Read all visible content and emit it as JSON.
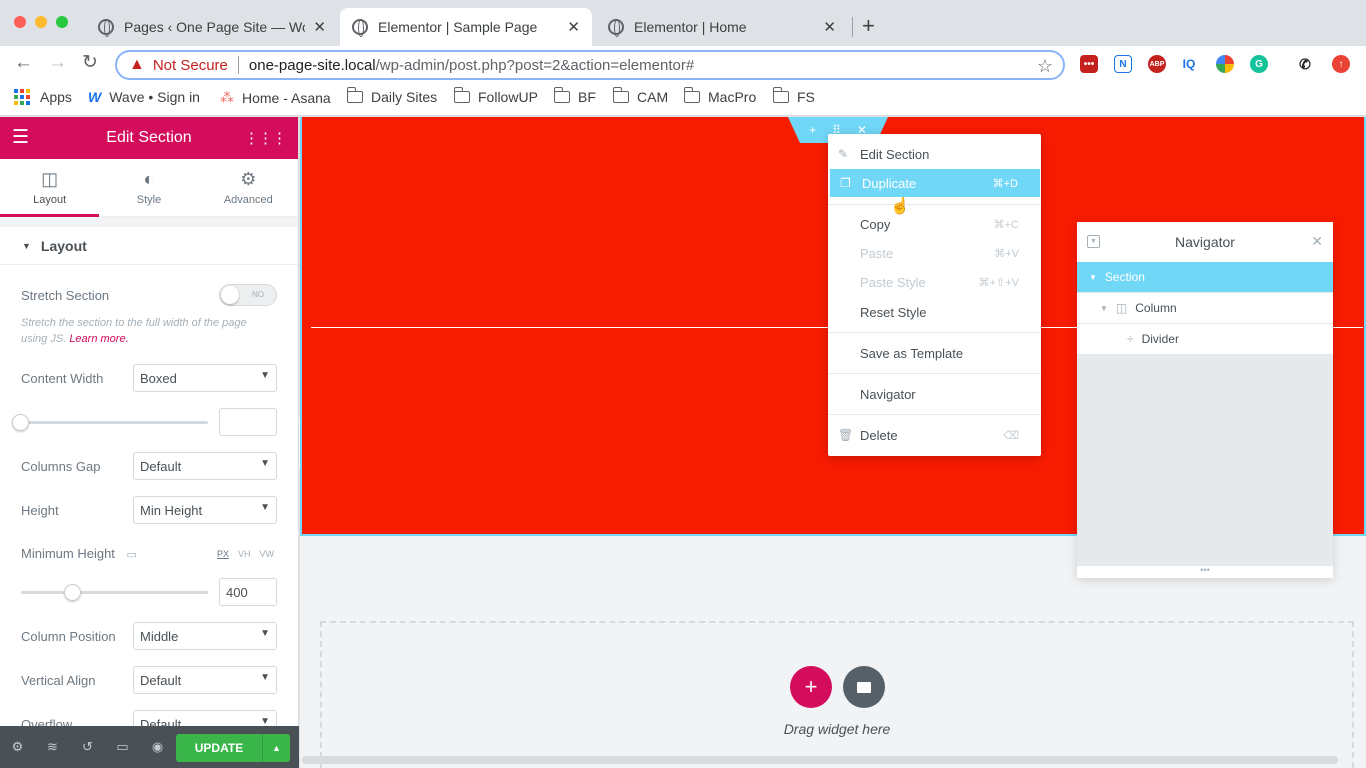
{
  "tabs": [
    {
      "title": "Pages ‹ One Page Site — Word",
      "active": false
    },
    {
      "title": "Elementor | Sample Page",
      "active": true
    },
    {
      "title": "Elementor | Home",
      "active": false
    }
  ],
  "address": {
    "security": "Not Secure",
    "host": "one-page-site.local",
    "path": "/wp-admin/post.php?post=2&action=elementor#"
  },
  "bookmarks": [
    "Apps",
    "Wave • Sign in",
    "Home - Asana",
    "Daily Sites",
    "FollowUP",
    "BF",
    "CAM",
    "MacPro",
    "FS"
  ],
  "extensions": [
    "IQ"
  ],
  "sidebar": {
    "title": "Edit Section",
    "tabs": [
      "Layout",
      "Style",
      "Advanced"
    ],
    "section": "Layout",
    "stretch_label": "Stretch Section",
    "stretch_toggle": "NO",
    "stretch_desc": "Stretch the section to the full width of the page using JS.",
    "learn_more": "Learn more.",
    "content_width_label": "Content Width",
    "content_width": "Boxed",
    "columns_gap_label": "Columns Gap",
    "columns_gap": "Default",
    "height_label": "Height",
    "height": "Min Height",
    "min_height_label": "Minimum Height",
    "units": [
      "PX",
      "VH",
      "VW"
    ],
    "min_height_value": "400",
    "column_position_label": "Column Position",
    "column_position": "Middle",
    "vertical_align_label": "Vertical Align",
    "vertical_align": "Default",
    "overflow_label": "Overflow",
    "overflow": "Default",
    "update": "UPDATE"
  },
  "context_menu": [
    {
      "label": "Edit Section",
      "shortcut": ""
    },
    {
      "label": "Duplicate",
      "shortcut": "⌘+D"
    },
    {
      "label": "Copy",
      "shortcut": "⌘+C"
    },
    {
      "label": "Paste",
      "shortcut": "⌘+V"
    },
    {
      "label": "Paste Style",
      "shortcut": "⌘+⇧+V"
    },
    {
      "label": "Reset Style",
      "shortcut": ""
    },
    {
      "label": "Save as Template",
      "shortcut": ""
    },
    {
      "label": "Navigator",
      "shortcut": ""
    },
    {
      "label": "Delete",
      "shortcut": ""
    }
  ],
  "navigator": {
    "title": "Navigator",
    "items": [
      "Section",
      "Column",
      "Divider"
    ]
  },
  "canvas": {
    "drag_text": "Drag widget here"
  },
  "colors": {
    "elementor_pink": "#d30c5c",
    "section_red": "#f71b00",
    "highlight": "#71d7f7",
    "update_green": "#39b54a"
  }
}
